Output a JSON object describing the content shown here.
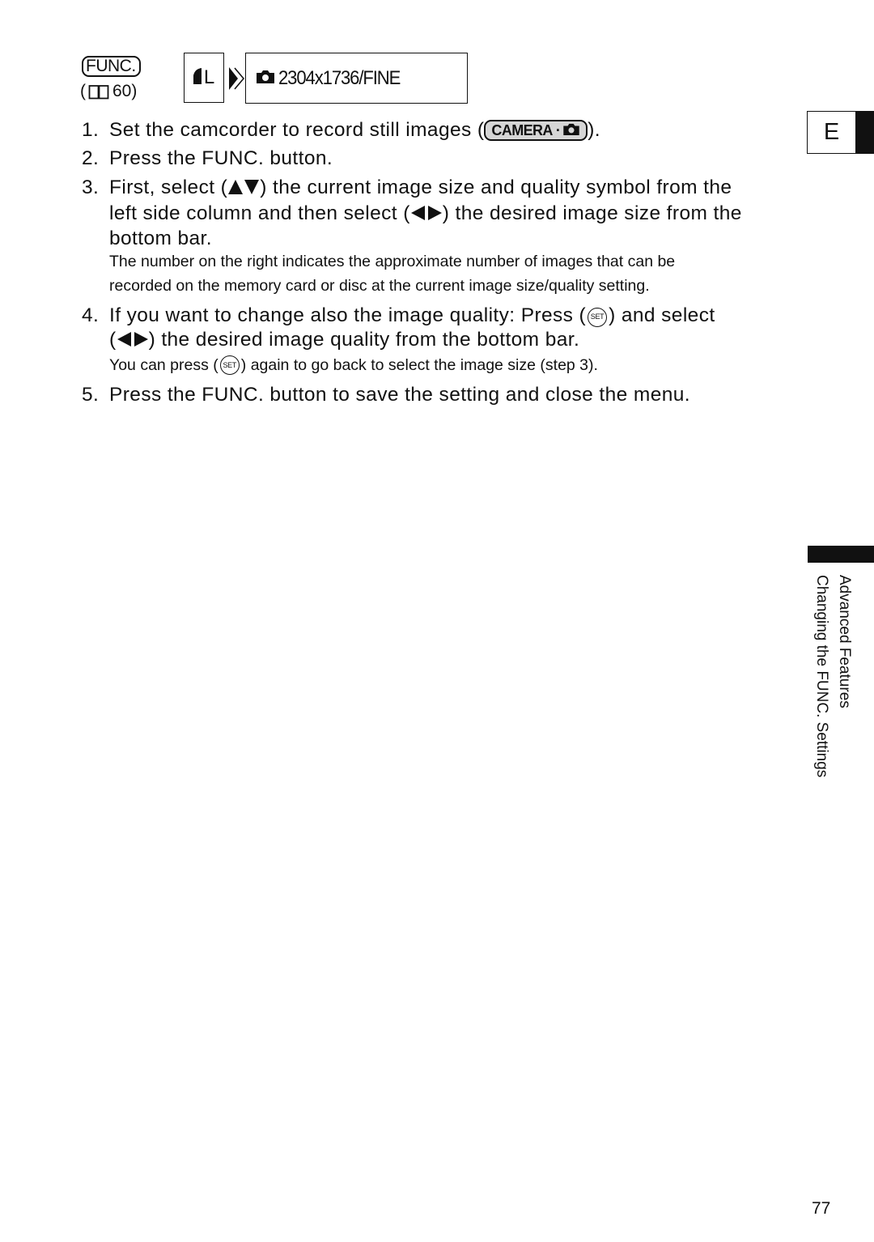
{
  "header": {
    "func_badge": "FUNC.",
    "page_ref_open": "(",
    "page_ref_number": "60",
    "page_ref_close": ")",
    "page_ref_icon": "book-icon"
  },
  "lcd_display": {
    "left_box": {
      "icon": "quality-fine-icon",
      "size_label": "L"
    },
    "arrow_icon": "double-chevron-right-icon",
    "main_box": {
      "icon": "camera-icon",
      "value": "2304x1736/FINE"
    }
  },
  "steps": [
    {
      "number": "1.",
      "text_before": "Set the camcorder to record still images (",
      "badge": {
        "label": "CAMERA",
        "separator": "·",
        "icon": "camera-icon"
      },
      "text_after": ")."
    },
    {
      "number": "2.",
      "text": "Press the FUNC. button."
    },
    {
      "number": "3.",
      "line1_before": "First, select (",
      "line1_icon": "up-down-arrows-icon",
      "line1_after": ") the current image size and quality symbol from the",
      "line2_before": "left side column and then select (",
      "line2_icon": "left-right-arrows-icon",
      "line2_after": ") the desired image size from the",
      "line3": "bottom bar.",
      "note_line1": "The number on the right indicates the approximate number of images that can be",
      "note_line2": "recorded on the memory card or disc at the current image size/quality setting."
    },
    {
      "number": "4.",
      "line1_before": "If you want to change also the image quality: Press (",
      "line1_icon_label": "SET",
      "line1_after": ") and select",
      "line2_before": "(",
      "line2_icon": "left-right-arrows-icon",
      "line2_after": ") the desired image quality from the bottom bar.",
      "note_before": "You can press (",
      "note_icon_label": "SET",
      "note_after": ") again to go back to select the image size (step 3)."
    },
    {
      "number": "5.",
      "text": "Press the FUNC. button to save the setting and close the menu."
    }
  ],
  "sidebar": {
    "language_tab": "E",
    "section_title": "Advanced Features",
    "subsection_title": "Changing the FUNC. Settings"
  },
  "footer": {
    "page_number": "77"
  }
}
